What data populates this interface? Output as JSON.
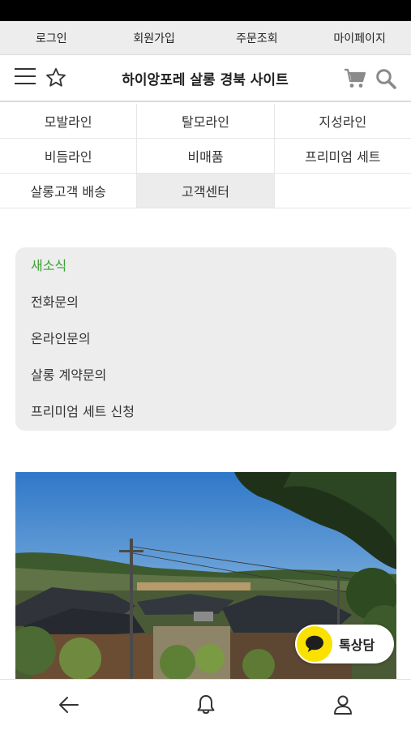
{
  "top_links": [
    "로그인",
    "회원가입",
    "주문조회",
    "마이페이지"
  ],
  "header": {
    "title": "하이앙포레 살롱 경북 사이트",
    "icons": [
      "menu-icon",
      "star-icon",
      "cart-icon",
      "search-icon"
    ]
  },
  "categories": [
    [
      "모발라인",
      "탈모라인",
      "지성라인"
    ],
    [
      "비듬라인",
      "비매품",
      "프리미엄 세트"
    ],
    [
      "살롱고객 배송",
      "고객센터",
      ""
    ]
  ],
  "active_category": "고객센터",
  "customer_service": {
    "items": [
      "새소식",
      "전화문의",
      "온라인문의",
      "살롱 계약문의",
      "프리미엄 세트 신청"
    ],
    "active": "새소식",
    "active_color": "#3aa135"
  },
  "kakao": {
    "label": "톡상담",
    "color": "#fae100"
  },
  "bottom_nav": [
    "back-arrow-icon",
    "bell-icon",
    "user-icon"
  ]
}
